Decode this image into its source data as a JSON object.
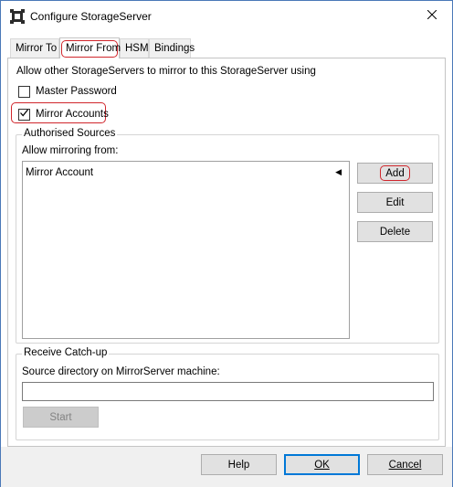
{
  "window": {
    "title": "Configure StorageServer"
  },
  "tabs": [
    {
      "label": "Mirror To"
    },
    {
      "label": "Mirror From"
    },
    {
      "label": "HSM"
    },
    {
      "label": "Bindings"
    }
  ],
  "active_tab": "Mirror From",
  "panel": {
    "intro": "Allow other StorageServers to mirror to this  StorageServer using",
    "master_password": {
      "label": "Master Password",
      "checked": false
    },
    "mirror_accounts": {
      "label": "Mirror Accounts",
      "checked": true
    },
    "authorised_sources": {
      "title": "Authorised Sources",
      "allow_label": "Allow mirroring from:",
      "items": [
        "Mirror Account"
      ],
      "add_label": "Add",
      "edit_label": "Edit",
      "delete_label": "Delete"
    },
    "receive_catchup": {
      "title": "Receive Catch-up",
      "source_label": "Source directory on MirrorServer machine:",
      "source_value": "",
      "start_label": "Start"
    }
  },
  "footer": {
    "help_label": "Help",
    "ok_label": "OK",
    "cancel_label": "Cancel"
  },
  "colors": {
    "highlight": "#d0262c",
    "window_border": "#4a78b8",
    "primary_button_border": "#0078d7"
  }
}
